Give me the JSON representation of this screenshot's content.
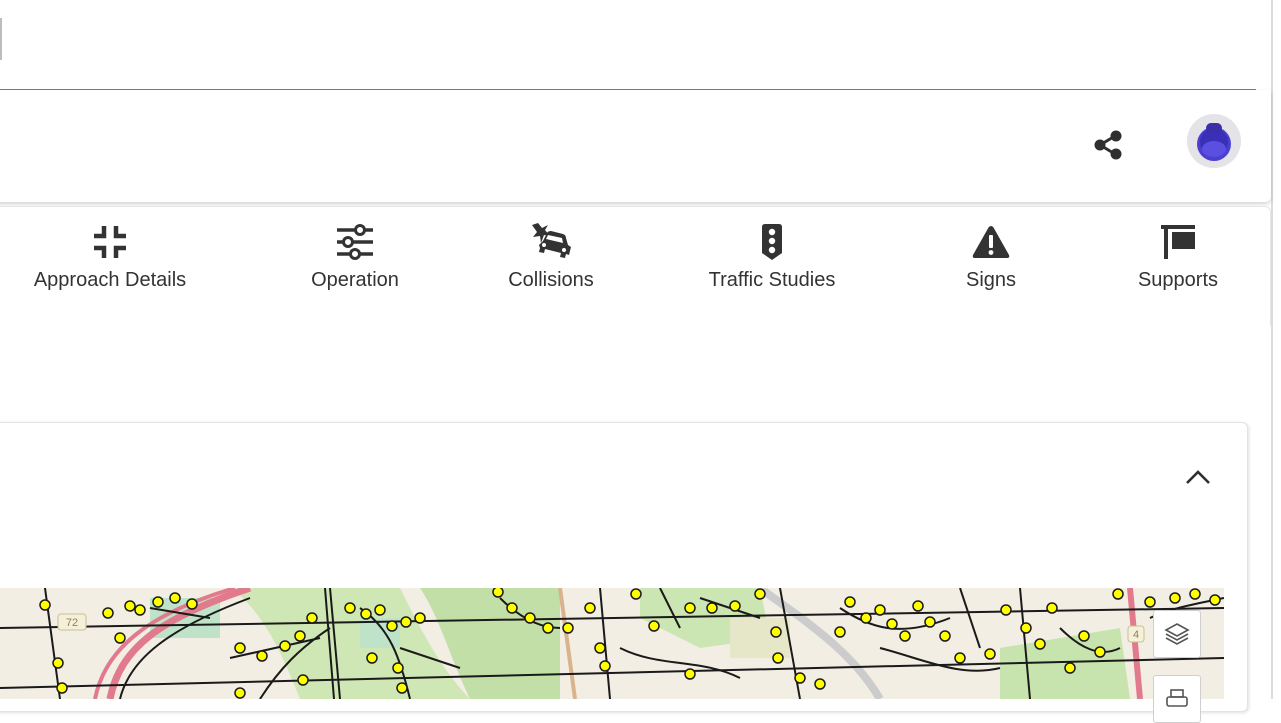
{
  "header": {
    "share_icon": "share-icon",
    "avatar_icon": "user-avatar",
    "avatar_color": "#4a3fd0"
  },
  "tabs": [
    {
      "label": "Approach Details",
      "icon": "compress-icon"
    },
    {
      "label": "Operation",
      "icon": "sliders-icon"
    },
    {
      "label": "Collisions",
      "icon": "car-crash-icon"
    },
    {
      "label": "Traffic Studies",
      "icon": "traffic-light-icon"
    },
    {
      "label": "Signs",
      "icon": "warning-sign-icon"
    },
    {
      "label": "Supports",
      "icon": "sign-post-icon"
    }
  ],
  "panel": {
    "collapse_icon": "chevron-up-icon"
  },
  "map": {
    "route_shield": "72",
    "route_shield_2": "4",
    "controls": [
      "layers-icon",
      "print-icon"
    ],
    "colors": {
      "node": "#ffff00",
      "road": "#1a1a1a",
      "park": "#c9e8b0",
      "highway": "#e27a8e"
    }
  }
}
